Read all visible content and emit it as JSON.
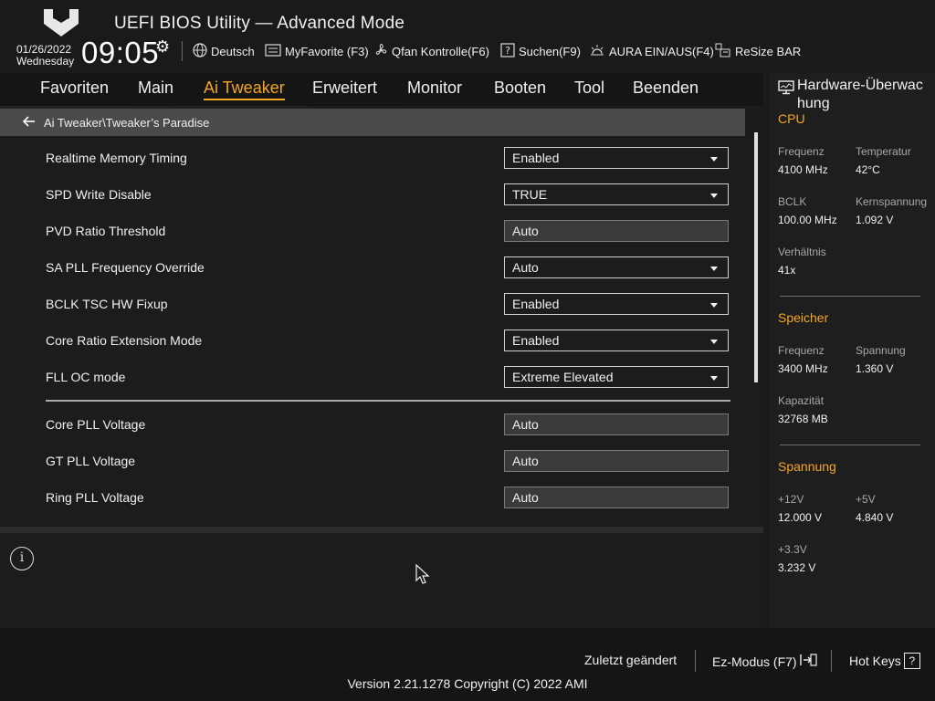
{
  "header": {
    "title": "UEFI BIOS Utility — Advanced Mode",
    "date": "01/26/2022",
    "weekday": "Wednesday",
    "time": "09:05",
    "toolbar": [
      {
        "icon": "globe-icon",
        "label": "Deutsch"
      },
      {
        "icon": "favorite-icon",
        "label": "MyFavorite (F3)"
      },
      {
        "icon": "fan-icon",
        "label": "Qfan Kontrolle(F6)"
      },
      {
        "icon": "question-icon",
        "label": "Suchen(F9)"
      },
      {
        "icon": "aura-icon",
        "label": "AURA EIN/AUS(F4)"
      },
      {
        "icon": "resize-bar-icon",
        "label": "ReSize BAR"
      }
    ]
  },
  "nav": {
    "tabs": [
      {
        "label": "Favoriten"
      },
      {
        "label": "Main"
      },
      {
        "label": "Ai Tweaker",
        "active": true
      },
      {
        "label": "Erweitert"
      },
      {
        "label": "Monitor"
      },
      {
        "label": "Booten"
      },
      {
        "label": "Tool"
      },
      {
        "label": "Beenden"
      }
    ]
  },
  "breadcrumb": "Ai Tweaker\\Tweaker’s Paradise",
  "settings": [
    {
      "label": "Realtime Memory Timing",
      "value": "Enabled",
      "type": "dropdown"
    },
    {
      "label": "SPD Write Disable",
      "value": "TRUE",
      "type": "dropdown"
    },
    {
      "label": "PVD Ratio Threshold",
      "value": "Auto",
      "type": "input"
    },
    {
      "label": "SA PLL Frequency Override",
      "value": "Auto",
      "type": "dropdown"
    },
    {
      "label": "BCLK TSC HW Fixup",
      "value": "Enabled",
      "type": "dropdown"
    },
    {
      "label": "Core Ratio Extension Mode",
      "value": "Enabled",
      "type": "dropdown"
    },
    {
      "label": "FLL OC mode",
      "value": "Extreme Elevated",
      "type": "dropdown"
    },
    {
      "label": "Core PLL Voltage",
      "value": "Auto",
      "type": "input"
    },
    {
      "label": "GT PLL Voltage",
      "value": "Auto",
      "type": "input"
    },
    {
      "label": "Ring PLL Voltage",
      "value": "Auto",
      "type": "input"
    }
  ],
  "hardware": {
    "title": "Hardware-Überwachung",
    "title_line1": "Hardware-Überwac",
    "title_line2": "hung",
    "cpu": {
      "heading": "CPU",
      "freq_label": "Frequenz",
      "freq": "4100 MHz",
      "temp_label": "Temperatur",
      "temp": "42°C",
      "bclk_label": "BCLK",
      "bclk": "100.00 MHz",
      "vcore_label": "Kernspannung",
      "vcore": "1.092 V",
      "ratio_label": "Verhältnis",
      "ratio": "41x"
    },
    "memory": {
      "heading": "Speicher",
      "freq_label": "Frequenz",
      "freq": "3400 MHz",
      "volt_label": "Spannung",
      "volt": "1.360 V",
      "cap_label": "Kapazität",
      "cap": "32768 MB"
    },
    "voltage": {
      "heading": "Spannung",
      "v12_label": "+12V",
      "v12": "12.000 V",
      "v5_label": "+5V",
      "v5": "4.840 V",
      "v33_label": "+3.3V",
      "v33": "3.232 V"
    }
  },
  "footer": {
    "last_changed": "Zuletzt geändert",
    "ez_mode": "Ez-Modus (F7)",
    "hot_keys": "Hot Keys",
    "version": "Version 2.21.1278 Copyright (C) 2022 AMI"
  },
  "colors": {
    "accent": "#f5a623",
    "background": "#1b1b1b",
    "breadcrumb_bg": "#4a4a4a"
  }
}
